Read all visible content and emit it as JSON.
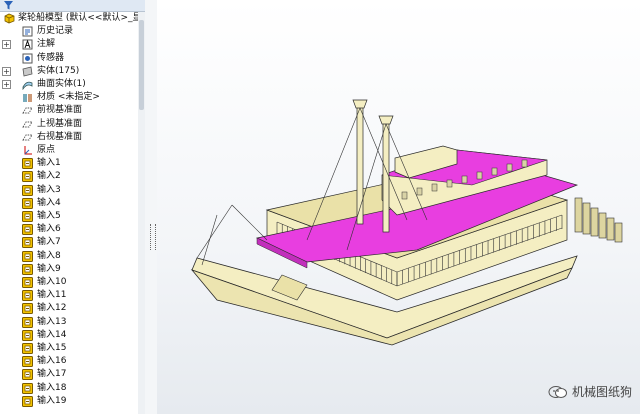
{
  "tree": {
    "root": {
      "label": "桨轮船模型 (默认<<默认>_显",
      "icon": "part-icon"
    },
    "items": [
      {
        "label": "历史记录",
        "icon": "history-icon",
        "expandable": false
      },
      {
        "label": "注解",
        "icon": "annotation-icon",
        "expandable": true
      },
      {
        "label": "传感器",
        "icon": "sensor-icon",
        "expandable": false
      },
      {
        "label": "实体(175)",
        "icon": "solid-bodies-icon",
        "expandable": true
      },
      {
        "label": "曲面实体(1)",
        "icon": "surface-bodies-icon",
        "expandable": true
      },
      {
        "label": "材质 <未指定>",
        "icon": "material-icon",
        "expandable": false
      },
      {
        "label": "前视基准面",
        "icon": "plane-icon",
        "expandable": false
      },
      {
        "label": "上视基准面",
        "icon": "plane-icon",
        "expandable": false
      },
      {
        "label": "右视基准面",
        "icon": "plane-icon",
        "expandable": false
      },
      {
        "label": "原点",
        "icon": "origin-icon",
        "expandable": false
      },
      {
        "label": "输入1",
        "icon": "import-feature-icon",
        "expandable": false
      },
      {
        "label": "输入2",
        "icon": "import-feature-icon",
        "expandable": false
      },
      {
        "label": "输入3",
        "icon": "import-feature-icon",
        "expandable": false
      },
      {
        "label": "输入4",
        "icon": "import-feature-icon",
        "expandable": false
      },
      {
        "label": "输入5",
        "icon": "import-feature-icon",
        "expandable": false
      },
      {
        "label": "输入6",
        "icon": "import-feature-icon",
        "expandable": false
      },
      {
        "label": "输入7",
        "icon": "import-feature-icon",
        "expandable": false
      },
      {
        "label": "输入8",
        "icon": "import-feature-icon",
        "expandable": false
      },
      {
        "label": "输入9",
        "icon": "import-feature-icon",
        "expandable": false
      },
      {
        "label": "输入10",
        "icon": "import-feature-icon",
        "expandable": false
      },
      {
        "label": "输入11",
        "icon": "import-feature-icon",
        "expandable": false
      },
      {
        "label": "输入12",
        "icon": "import-feature-icon",
        "expandable": false
      },
      {
        "label": "输入13",
        "icon": "import-feature-icon",
        "expandable": false
      },
      {
        "label": "输入14",
        "icon": "import-feature-icon",
        "expandable": false
      },
      {
        "label": "输入15",
        "icon": "import-feature-icon",
        "expandable": false
      },
      {
        "label": "输入16",
        "icon": "import-feature-icon",
        "expandable": false
      },
      {
        "label": "输入17",
        "icon": "import-feature-icon",
        "expandable": false
      },
      {
        "label": "输入18",
        "icon": "import-feature-icon",
        "expandable": false
      },
      {
        "label": "输入19",
        "icon": "import-feature-icon",
        "expandable": false
      }
    ]
  },
  "watermark": {
    "text": "机械图纸狗",
    "icon": "wechat-icon"
  },
  "colors": {
    "hull": "#f4eec2",
    "deck_highlight": "#e83ee0",
    "line": "#2a2a2a",
    "tree_icon_yellow": "#f2c200"
  }
}
